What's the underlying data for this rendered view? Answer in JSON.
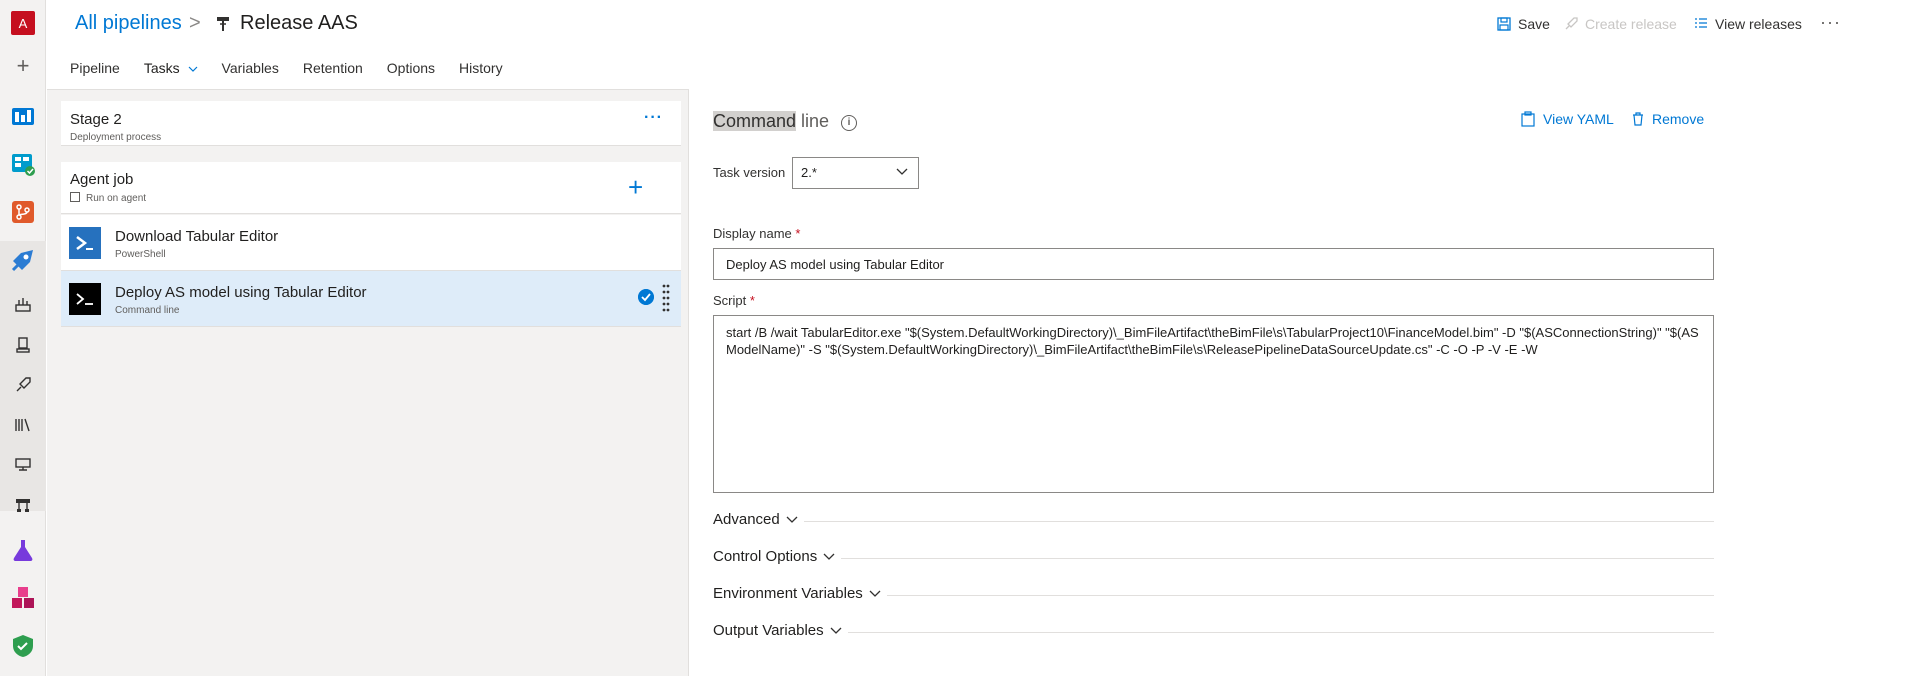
{
  "rail": {
    "org_letter": "A",
    "colors": {
      "org": "#c50f1f",
      "boards": "#0078d4",
      "repos": "#e05a2b",
      "test": "#773adc",
      "artifacts": "#c2185b",
      "security": "#2e9e4f"
    }
  },
  "header": {
    "breadcrumb_root": "All pipelines",
    "breadcrumb_separator": ">",
    "title": "Release AAS",
    "save_label": "Save",
    "create_release_label": "Create release",
    "view_releases_label": "View releases",
    "more_label": "···"
  },
  "tabs": [
    {
      "label": "Pipeline"
    },
    {
      "label": "Tasks"
    },
    {
      "label": "Variables"
    },
    {
      "label": "Retention"
    },
    {
      "label": "Options"
    },
    {
      "label": "History"
    }
  ],
  "left": {
    "stage_name": "Stage 2",
    "stage_sub": "Deployment process",
    "agent_job_name": "Agent job",
    "agent_job_sub": "Run on agent",
    "tasks": [
      {
        "name": "Download Tabular Editor",
        "sub": "PowerShell"
      },
      {
        "name": "Deploy AS model using Tabular Editor",
        "sub": "Command line"
      }
    ]
  },
  "right": {
    "title_highlight": "Command",
    "title_rest": " line",
    "view_yaml_label": "View YAML",
    "remove_label": "Remove",
    "task_version_label": "Task version",
    "task_version_value": "2.*",
    "display_name_label": "Display name",
    "display_name_value": "Deploy AS model using Tabular Editor",
    "script_label": "Script",
    "script_value": "start /B /wait TabularEditor.exe \"$(System.DefaultWorkingDirectory)\\_BimFileArtifact\\theBimFile\\s\\TabularProject10\\FinanceModel.bim\" -D \"$(ASConnectionString)\" \"$(ASModelName)\" -S \"$(System.DefaultWorkingDirectory)\\_BimFileArtifact\\theBimFile\\s\\ReleasePipelineDataSourceUpdate.cs\" -C -O -P -V -E -W",
    "required_mark": "*",
    "sections": [
      {
        "label": "Advanced"
      },
      {
        "label": "Control Options"
      },
      {
        "label": "Environment Variables"
      },
      {
        "label": "Output Variables"
      }
    ]
  }
}
